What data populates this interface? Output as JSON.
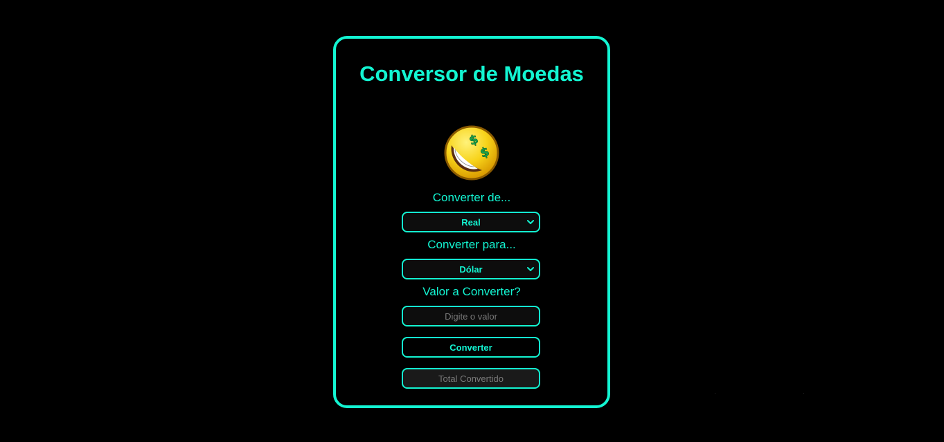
{
  "card": {
    "title": "Conversor de Moedas"
  },
  "emoji": {
    "icon": "money-mouth-emoji-icon"
  },
  "from": {
    "label": "Converter de...",
    "selected": "Real"
  },
  "to": {
    "label": "Converter para...",
    "selected": "Dólar"
  },
  "amount": {
    "label": "Valor a Converter?",
    "placeholder": "Digite o valor"
  },
  "convert_button": {
    "label": "Converter"
  },
  "result": {
    "placeholder": "Total Convertido"
  },
  "colors": {
    "accent": "#13f5d2",
    "background": "#000000"
  }
}
